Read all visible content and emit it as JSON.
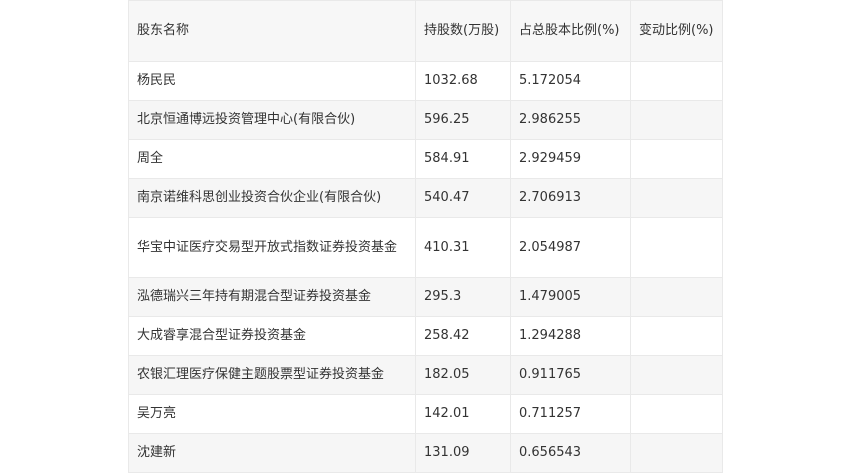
{
  "table": {
    "headers": [
      "股东名称",
      "持股数(万股)",
      "占总股本比例(%)",
      "变动比例(%)"
    ],
    "rows": [
      [
        "杨民民",
        "1032.68",
        "5.172054",
        ""
      ],
      [
        "北京恒通博远投资管理中心(有限合伙)",
        "596.25",
        "2.986255",
        ""
      ],
      [
        "周全",
        "584.91",
        "2.929459",
        ""
      ],
      [
        "南京诺维科思创业投资合伙企业(有限合伙)",
        "540.47",
        "2.706913",
        ""
      ],
      [
        "华宝中证医疗交易型开放式指数证券投资基金",
        "410.31",
        "2.054987",
        ""
      ],
      [
        "泓德瑞兴三年持有期混合型证券投资基金",
        "295.3",
        "1.479005",
        ""
      ],
      [
        "大成睿享混合型证券投资基金",
        "258.42",
        "1.294288",
        ""
      ],
      [
        "农银汇理医疗保健主题股票型证券投资基金",
        "182.05",
        "0.911765",
        ""
      ],
      [
        "吴万亮",
        "142.01",
        "0.711257",
        ""
      ],
      [
        "沈建新",
        "131.09",
        "0.656543",
        ""
      ]
    ]
  }
}
